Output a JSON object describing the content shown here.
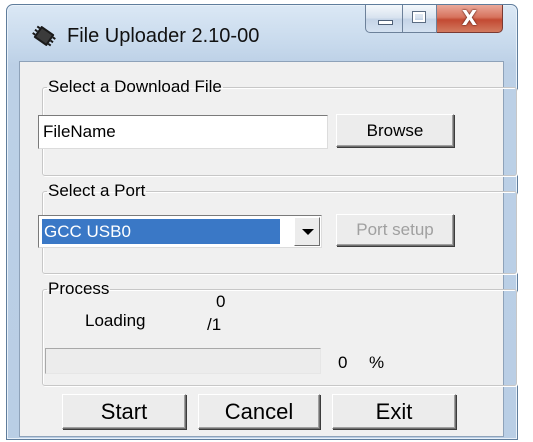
{
  "window": {
    "title": "File Uploader 2.10-00",
    "close_glyph": "X"
  },
  "file_group": {
    "legend": "Select a Download File",
    "file_input_value": "FileName",
    "browse_label": "Browse"
  },
  "port_group": {
    "legend": "Select a Port",
    "selected_port": "GCC USB0",
    "port_setup_label": "Port setup",
    "port_setup_enabled": false
  },
  "process_group": {
    "legend": "Process",
    "status_label": "Loading",
    "loaded_count": "0",
    "total_count": "/1",
    "progress_percent": 0,
    "percent_value": "0",
    "percent_sign": "%"
  },
  "buttons": {
    "start_label": "Start",
    "cancel_label": "Cancel",
    "exit_label": "Exit"
  },
  "colors": {
    "selection": "#3a78c6",
    "close_button": "#c34a33",
    "disabled_text": "#a0a0a0"
  },
  "icons": {
    "app_icon": "chip-icon",
    "dropdown": "dropdown-arrow-icon"
  }
}
